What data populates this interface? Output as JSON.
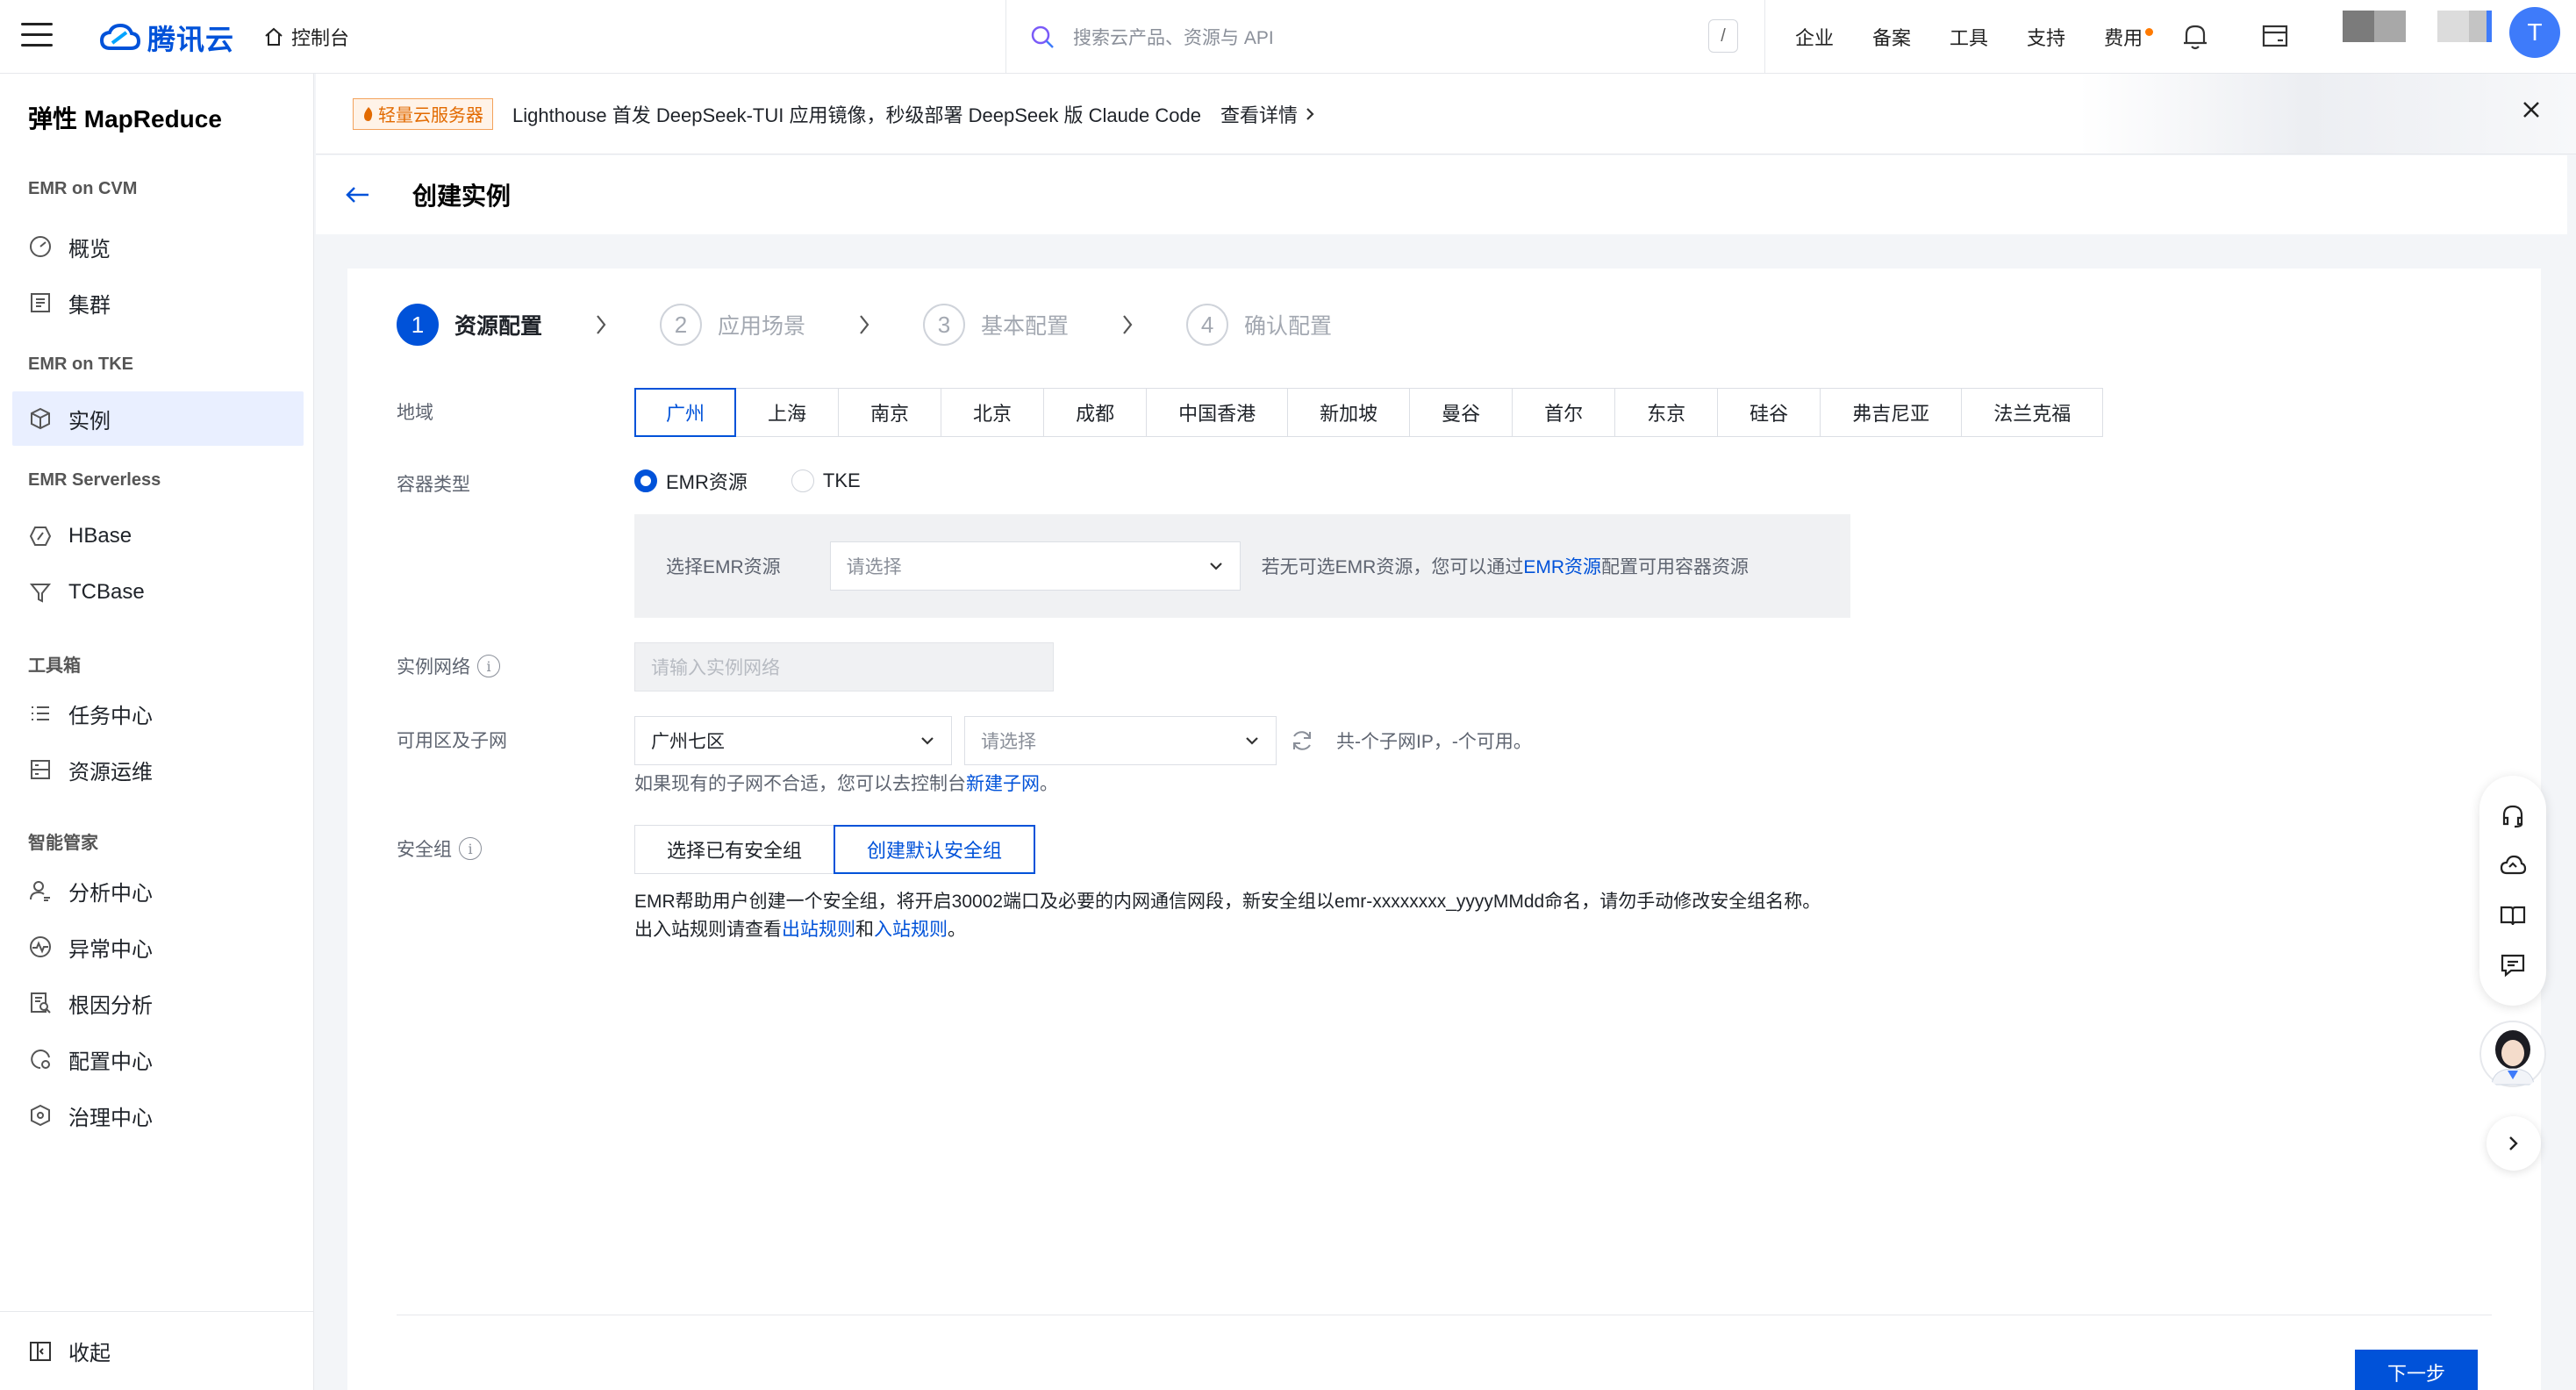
{
  "topbar": {
    "brand": "腾讯云",
    "console": "控制台",
    "search_placeholder": "搜索云产品、资源与 API",
    "search_shortcut": "/",
    "nav": [
      "企业",
      "备案",
      "工具",
      "支持",
      "费用"
    ],
    "avatar_initial": "T"
  },
  "sidebar": {
    "title": "弹性 MapReduce",
    "groups": {
      "cvm": "EMR on CVM",
      "tke": "EMR on TKE",
      "serverless": "EMR Serverless",
      "toolbox": "工具箱",
      "butler": "智能管家"
    },
    "items": {
      "overview": "概览",
      "cluster": "集群",
      "instance": "实例",
      "hbase": "HBase",
      "tcbase": "TCBase",
      "task_center": "任务中心",
      "resource_ops": "资源运维",
      "analysis_center": "分析中心",
      "anomaly_center": "异常中心",
      "root_cause": "根因分析",
      "config_center": "配置中心",
      "governance_center": "治理中心"
    },
    "collapse": "收起"
  },
  "banner": {
    "tag": "轻量云服务器",
    "text": "Lighthouse 首发 DeepSeek-TUI 应用镜像，秒级部署 DeepSeek 版 Claude Code",
    "link": "查看详情"
  },
  "page": {
    "title": "创建实例"
  },
  "steps": [
    {
      "num": "1",
      "label": "资源配置"
    },
    {
      "num": "2",
      "label": "应用场景"
    },
    {
      "num": "3",
      "label": "基本配置"
    },
    {
      "num": "4",
      "label": "确认配置"
    }
  ],
  "form": {
    "region_label": "地域",
    "regions": [
      "广州",
      "上海",
      "南京",
      "北京",
      "成都",
      "中国香港",
      "新加坡",
      "曼谷",
      "首尔",
      "东京",
      "硅谷",
      "弗吉尼亚",
      "法兰克福"
    ],
    "container_label": "容器类型",
    "container_options": [
      "EMR资源",
      "TKE"
    ],
    "emr_resource_label": "选择EMR资源",
    "emr_resource_placeholder": "请选择",
    "emr_hint_before": "若无可选EMR资源，您可以通过",
    "emr_hint_link": "EMR资源",
    "emr_hint_after": "配置可用容器资源",
    "network_label": "实例网络",
    "network_placeholder": "请输入实例网络",
    "az_label": "可用区及子网",
    "az_value": "广州七区",
    "subnet_placeholder": "请选择",
    "subnet_info": "共-个子网IP，-个可用。",
    "subnet_help_before": "如果现有的子网不合适，您可以去控制台",
    "subnet_help_link": "新建子网",
    "subnet_help_after": "。",
    "sg_label": "安全组",
    "sg_options": [
      "选择已有安全组",
      "创建默认安全组"
    ],
    "sg_desc": "EMR帮助用户创建一个安全组，将开启30002端口及必要的内网通信网段，新安全组以emr-xxxxxxxx_yyyyMMdd命名，请勿手动修改安全组名称。",
    "sg_rules_before": "出入站规则请查看",
    "sg_rules_out": "出站规则",
    "sg_rules_and": "和",
    "sg_rules_in": "入站规则",
    "sg_rules_after": "。"
  },
  "actions": {
    "next": "下一步"
  },
  "colors": {
    "primary": "#0052d9",
    "active_bg": "#e9efff",
    "tag_orange": "#e26a00"
  }
}
